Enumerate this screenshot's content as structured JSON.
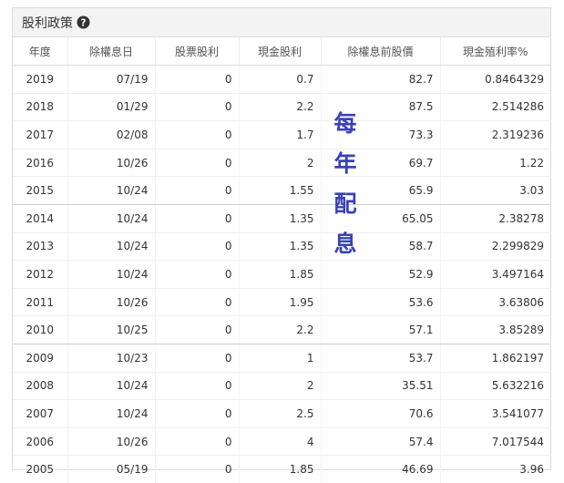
{
  "header": {
    "title": "股利政策",
    "help_icon": "question-circle-icon"
  },
  "table": {
    "columns": [
      "年度",
      "除權息日",
      "股票股利",
      "現金股利",
      "除權息前股價",
      "現金殖利率%"
    ],
    "rows": [
      [
        "2019",
        "07/19",
        "0",
        "0.7",
        "82.7",
        "0.8464329"
      ],
      [
        "2018",
        "01/29",
        "0",
        "2.2",
        "87.5",
        "2.514286"
      ],
      [
        "2017",
        "02/08",
        "0",
        "1.7",
        "73.3",
        "2.319236"
      ],
      [
        "2016",
        "10/26",
        "0",
        "2",
        "69.7",
        "1.22"
      ],
      [
        "2015",
        "10/24",
        "0",
        "1.55",
        "65.9",
        "3.03"
      ],
      [
        "2014",
        "10/24",
        "0",
        "1.35",
        "65.05",
        "2.38278"
      ],
      [
        "2013",
        "10/24",
        "0",
        "1.35",
        "58.7",
        "2.299829"
      ],
      [
        "2012",
        "10/24",
        "0",
        "1.85",
        "52.9",
        "3.497164"
      ],
      [
        "2011",
        "10/26",
        "0",
        "1.95",
        "53.6",
        "3.63806"
      ],
      [
        "2010",
        "10/25",
        "0",
        "2.2",
        "57.1",
        "3.85289"
      ],
      [
        "2009",
        "10/23",
        "0",
        "1",
        "53.7",
        "1.862197"
      ],
      [
        "2008",
        "10/24",
        "0",
        "2",
        "35.51",
        "5.632216"
      ],
      [
        "2007",
        "10/24",
        "0",
        "2.5",
        "70.6",
        "3.541077"
      ],
      [
        "2006",
        "10/26",
        "0",
        "4",
        "57.4",
        "7.017544"
      ],
      [
        "2005",
        "05/19",
        "0",
        "1.85",
        "46.69",
        "3.96"
      ]
    ]
  },
  "annotation": {
    "chars": [
      "每",
      "年",
      "配",
      "息"
    ],
    "color": "#3a41b8"
  }
}
